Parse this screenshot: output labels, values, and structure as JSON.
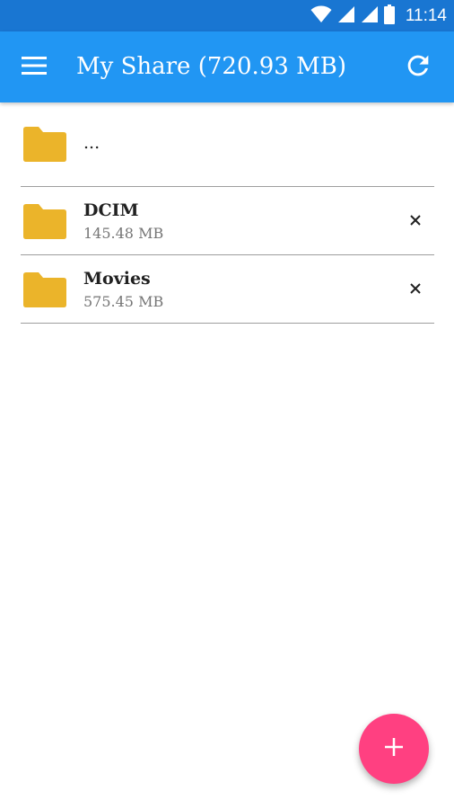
{
  "status_bar": {
    "time": "11:14",
    "icons": [
      "wifi-icon",
      "signal-icon",
      "signal-icon",
      "battery-icon"
    ]
  },
  "app_bar": {
    "title": "My Share (720.93 MB)",
    "menu_icon": "menu-icon",
    "refresh_icon": "refresh-icon"
  },
  "list": {
    "parent": {
      "label": "..."
    },
    "items": [
      {
        "name": "DCIM",
        "size": "145.48 MB"
      },
      {
        "name": "Movies",
        "size": "575.45 MB"
      }
    ]
  },
  "fab": {
    "icon": "add-icon"
  },
  "colors": {
    "status_bar": "#1976D2",
    "app_bar": "#2196F3",
    "folder": "#EBB42A",
    "fab": "#FF4081"
  }
}
